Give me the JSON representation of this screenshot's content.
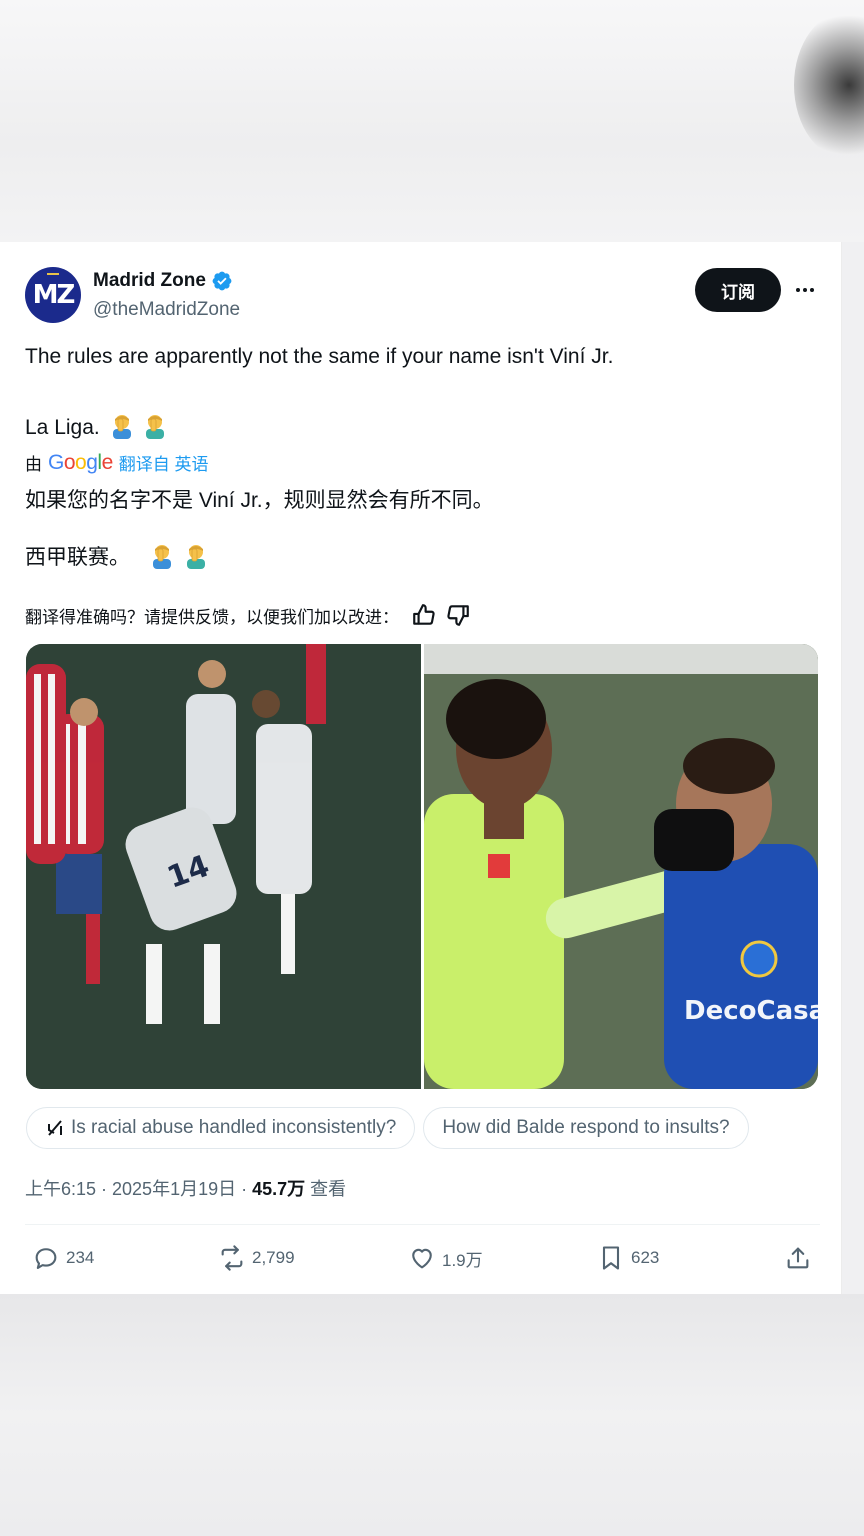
{
  "tweet": {
    "display_name": "Madrid Zone",
    "handle": "@theMadridZone",
    "avatar_text": "MZ",
    "subscribe_label": "订阅",
    "text_line1": "The rules are apparently not the same if your name isn't Viní Jr.",
    "text_line2": "La Liga.",
    "translated_by_prefix": "由",
    "translated_by_brand": "Google",
    "translate_link": "翻译自 英语",
    "translation_line1": "如果您的名字不是 Viní Jr.，规则显然会有所不同。",
    "translation_line2": "西甲联赛。",
    "feedback_prompt": "翻译得准确吗？请提供反馈，以便我们加以改进：",
    "timestamp": "上午6:15 · 2025年1月19日 · ",
    "views_count": "45.7万",
    "views_label": " 查看"
  },
  "chips": [
    {
      "label": "Is racial abuse handled inconsistently?",
      "icon": "grok-icon"
    },
    {
      "label": "How did Balde respond to insults?"
    }
  ],
  "actions": {
    "replies": "234",
    "reposts": "2,799",
    "likes": "1.9万",
    "bookmarks": "623"
  },
  "colors": {
    "accent": "#1d9bf0",
    "text_primary": "#0f1419",
    "text_secondary": "#536471",
    "avatar_bg": "#1b2a8c",
    "verified": "#1d9bf0"
  },
  "icons": [
    "verified-badge-icon",
    "more-options-icon",
    "man-facepalming-emoji",
    "thumbs-up-icon",
    "thumbs-down-icon",
    "grok-icon",
    "reply-icon",
    "repost-icon",
    "like-icon",
    "bookmark-icon",
    "share-icon"
  ]
}
